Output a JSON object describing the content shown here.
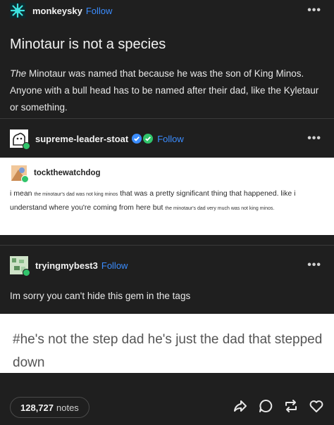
{
  "post": {
    "author": {
      "username": "monkeysky",
      "follow": "Follow",
      "more": "•••"
    },
    "title": "Minotaur is not a species",
    "body": {
      "prefix": "The",
      "text": " Minotaur was named that because he was the son of King Minos. Anyone with a bull head has to be named after their dad, like the Kyletaur or something."
    }
  },
  "reblog1": {
    "username": "supreme-leader-stoat",
    "follow": "Follow",
    "more": "•••"
  },
  "quoted": {
    "username": "tockthewatchdog",
    "parts": [
      "i mean ",
      "the minotaur's dad was not king minos",
      " that was a pretty significant thing that happened. like i understand where you're coming from here but ",
      "the minotaur's dad very much was not king minos."
    ]
  },
  "reblog2": {
    "username": "tryingmybest3",
    "follow": "Follow",
    "more": "•••",
    "text": "Im sorry you can't hide this gem in the tags"
  },
  "tag_text": "#he's not the step dad he's just the dad that stepped down",
  "footer": {
    "notes_count": "128,727",
    "notes_label": "notes"
  },
  "icons": [
    "share-icon",
    "reply-icon",
    "reblog-icon",
    "like-icon"
  ],
  "colors": {
    "background": "#1f1f1f",
    "follow": "#3b8dff",
    "badge": "#31c46b"
  }
}
